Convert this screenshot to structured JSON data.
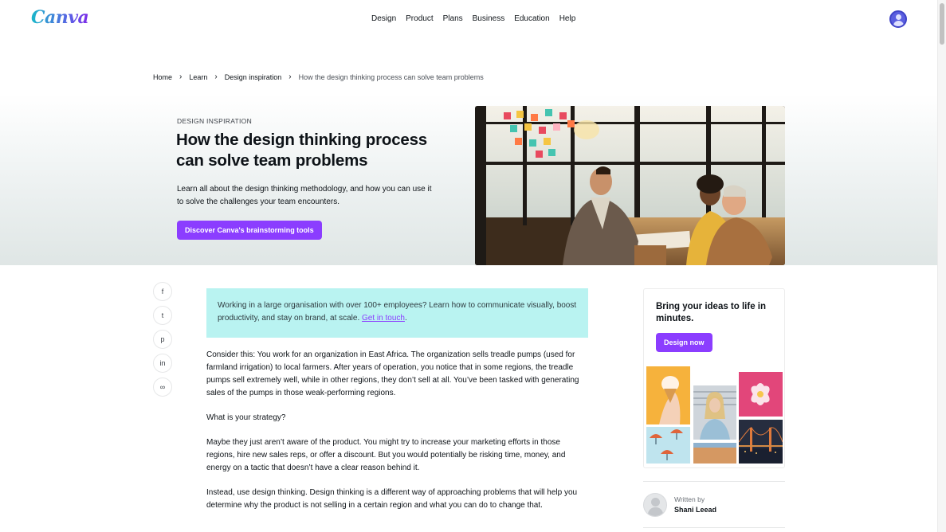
{
  "header": {
    "logo": "Canva",
    "nav": [
      {
        "label": "Design"
      },
      {
        "label": "Product"
      },
      {
        "label": "Plans"
      },
      {
        "label": "Business"
      },
      {
        "label": "Education"
      },
      {
        "label": "Help"
      }
    ],
    "account_icon": "user-avatar-icon"
  },
  "breadcrumb": {
    "items": [
      {
        "label": "Home"
      },
      {
        "label": "Learn"
      },
      {
        "label": "Design inspiration"
      }
    ],
    "current": "How the design thinking process can solve team problems",
    "separator": "›"
  },
  "hero": {
    "eyebrow": "DESIGN INSPIRATION",
    "title": "How the design thinking process can solve team problems",
    "description": "Learn all about the design thinking methodology, and how you can use it to solve the challenges your team encounters.",
    "cta": "Discover Canva's brainstorming tools"
  },
  "share": {
    "icons": [
      "facebook-icon",
      "twitter-icon",
      "pinterest-icon",
      "linkedin-icon",
      "link-icon"
    ],
    "glyphs": [
      "f",
      "t",
      "p",
      "in",
      "∞"
    ]
  },
  "callout": {
    "text": "Working in a large organisation with over 100+ employees? Learn how to communicate visually, boost productivity, and stay on brand, at scale. ",
    "link": "Get in touch",
    "after": "."
  },
  "article": {
    "paragraphs": [
      "Consider this: You work for an organization in East Africa. The organization sells treadle pumps (used for farmland irrigation) to local farmers. After years of operation, you notice that in some regions, the treadle pumps sell extremely well, while in other regions, they don’t sell at all. You’ve been tasked with generating sales of the pumps in those weak-performing regions.",
      "What is your strategy?",
      "Maybe they just aren’t aware of the product. You might try to increase your marketing efforts in those regions, hire new sales reps, or offer a discount. But you would potentially be risking time, money, and energy on a tactic that doesn’t have a clear reason behind it.",
      "Instead, use design thinking. Design thinking is a different way of approaching problems that will help you determine why the product is not selling in a certain region and what you can do to change that."
    ]
  },
  "promo": {
    "title": "Bring your ideas to life in minutes.",
    "cta": "Design now"
  },
  "author": {
    "written_by": "Written by",
    "name": "Shani Leead"
  },
  "colors": {
    "brand_purple": "#8b3dff",
    "callout_bg": "#b9f3f1",
    "avatar_blue": "#5b5fe0"
  }
}
